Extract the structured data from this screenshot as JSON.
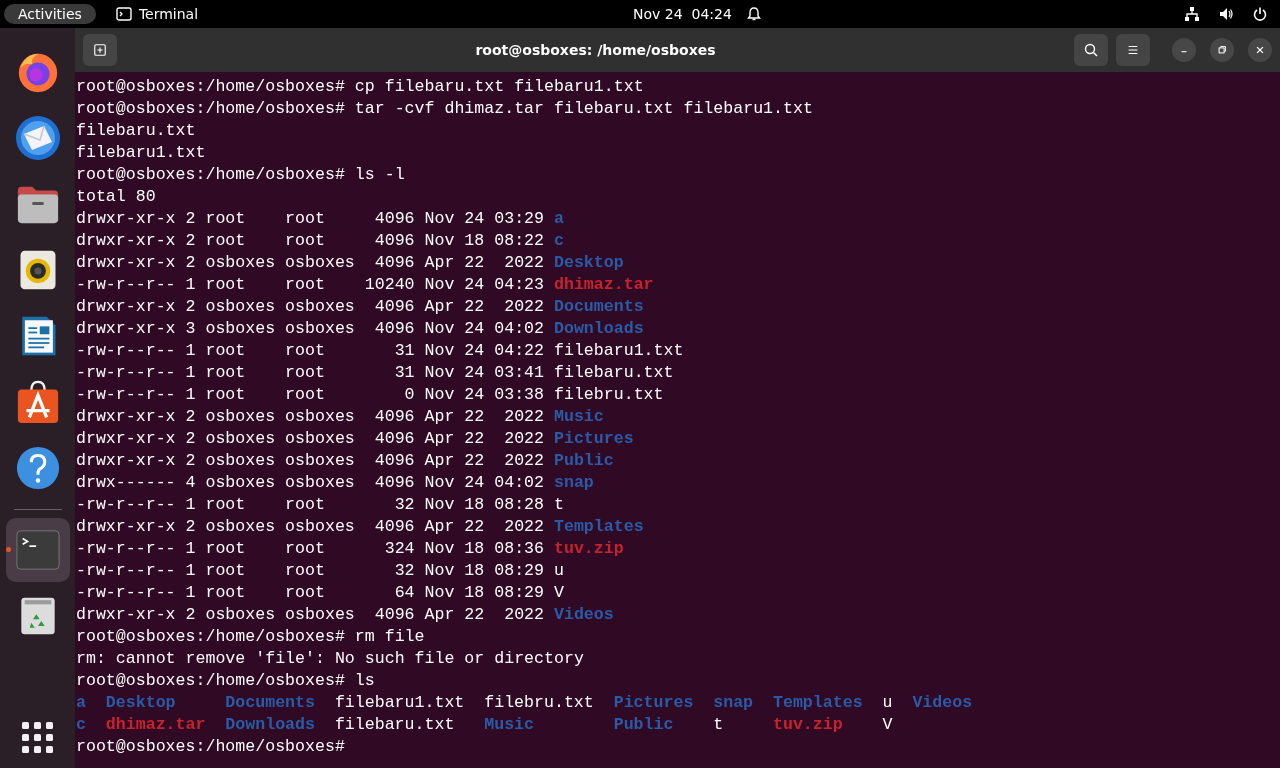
{
  "top_bar": {
    "activities": "Activities",
    "app_name": "Terminal",
    "clock": "Nov 24  04:24"
  },
  "dock": [
    {
      "kind": "browser",
      "running": false,
      "active": false
    },
    {
      "kind": "mail",
      "running": false,
      "active": false
    },
    {
      "kind": "files",
      "running": false,
      "active": false
    },
    {
      "kind": "music",
      "running": false,
      "active": false
    },
    {
      "kind": "writer",
      "running": false,
      "active": false
    },
    {
      "kind": "software",
      "running": false,
      "active": false
    },
    {
      "kind": "help",
      "running": false,
      "active": false
    },
    {
      "kind": "separator"
    },
    {
      "kind": "terminal",
      "running": true,
      "active": true
    },
    {
      "kind": "trash",
      "running": false,
      "active": false
    }
  ],
  "window": {
    "title": "root@osboxes: /home/osboxes"
  },
  "terminal": {
    "lines": [
      {
        "kind": "text",
        "text": "root@osboxes:/home/osboxes# cp filebaru.txt filebaru1.txt"
      },
      {
        "kind": "text",
        "text": "root@osboxes:/home/osboxes# tar -cvf dhimaz.tar filebaru.txt filebaru1.txt"
      },
      {
        "kind": "text",
        "text": "filebaru.txt"
      },
      {
        "kind": "text",
        "text": "filebaru1.txt"
      },
      {
        "kind": "text",
        "text": "root@osboxes:/home/osboxes# ls -l"
      },
      {
        "kind": "text",
        "text": "total 80"
      },
      {
        "kind": "entry",
        "info": "drwxr-xr-x 2 root    root     4096 Nov 24 03:29",
        "file": {
          "name": "a",
          "kind": "dir"
        }
      },
      {
        "kind": "entry",
        "info": "drwxr-xr-x 2 root    root     4096 Nov 18 08:22",
        "file": {
          "name": "c",
          "kind": "dir"
        }
      },
      {
        "kind": "entry",
        "info": "drwxr-xr-x 2 osboxes osboxes  4096 Apr 22  2022",
        "file": {
          "name": "Desktop",
          "kind": "dir"
        }
      },
      {
        "kind": "entry",
        "info": "-rw-r--r-- 1 root    root    10240 Nov 24 04:23",
        "file": {
          "name": "dhimaz.tar",
          "kind": "archive"
        }
      },
      {
        "kind": "entry",
        "info": "drwxr-xr-x 2 osboxes osboxes  4096 Apr 22  2022",
        "file": {
          "name": "Documents",
          "kind": "dir"
        }
      },
      {
        "kind": "entry",
        "info": "drwxr-xr-x 3 osboxes osboxes  4096 Nov 24 04:02",
        "file": {
          "name": "Downloads",
          "kind": "dir"
        }
      },
      {
        "kind": "entry",
        "info": "-rw-r--r-- 1 root    root       31 Nov 24 04:22",
        "file": {
          "name": "filebaru1.txt",
          "kind": "file"
        }
      },
      {
        "kind": "entry",
        "info": "-rw-r--r-- 1 root    root       31 Nov 24 03:41",
        "file": {
          "name": "filebaru.txt",
          "kind": "file"
        }
      },
      {
        "kind": "entry",
        "info": "-rw-r--r-- 1 root    root        0 Nov 24 03:38",
        "file": {
          "name": "filebru.txt",
          "kind": "file"
        }
      },
      {
        "kind": "entry",
        "info": "drwxr-xr-x 2 osboxes osboxes  4096 Apr 22  2022",
        "file": {
          "name": "Music",
          "kind": "dir"
        }
      },
      {
        "kind": "entry",
        "info": "drwxr-xr-x 2 osboxes osboxes  4096 Apr 22  2022",
        "file": {
          "name": "Pictures",
          "kind": "dir"
        }
      },
      {
        "kind": "entry",
        "info": "drwxr-xr-x 2 osboxes osboxes  4096 Apr 22  2022",
        "file": {
          "name": "Public",
          "kind": "dir"
        }
      },
      {
        "kind": "entry",
        "info": "drwx------ 4 osboxes osboxes  4096 Nov 24 04:02",
        "file": {
          "name": "snap",
          "kind": "dir"
        }
      },
      {
        "kind": "entry",
        "info": "-rw-r--r-- 1 root    root       32 Nov 18 08:28",
        "file": {
          "name": "t",
          "kind": "file"
        }
      },
      {
        "kind": "entry",
        "info": "drwxr-xr-x 2 osboxes osboxes  4096 Apr 22  2022",
        "file": {
          "name": "Templates",
          "kind": "dir"
        }
      },
      {
        "kind": "entry",
        "info": "-rw-r--r-- 1 root    root      324 Nov 18 08:36",
        "file": {
          "name": "tuv.zip",
          "kind": "archive"
        }
      },
      {
        "kind": "entry",
        "info": "-rw-r--r-- 1 root    root       32 Nov 18 08:29",
        "file": {
          "name": "u",
          "kind": "file"
        }
      },
      {
        "kind": "entry",
        "info": "-rw-r--r-- 1 root    root       64 Nov 18 08:29",
        "file": {
          "name": "V",
          "kind": "file"
        }
      },
      {
        "kind": "entry",
        "info": "drwxr-xr-x 2 osboxes osboxes  4096 Apr 22  2022",
        "file": {
          "name": "Videos",
          "kind": "dir"
        }
      },
      {
        "kind": "text",
        "text": "root@osboxes:/home/osboxes# rm file"
      },
      {
        "kind": "text",
        "text": "rm: cannot remove 'file': No such file or directory"
      },
      {
        "kind": "text",
        "text": "root@osboxes:/home/osboxes# ls"
      },
      {
        "kind": "columns",
        "columns": [
          [
            {
              "name": "a",
              "kind": "dir"
            },
            {
              "name": "c",
              "kind": "dir"
            }
          ],
          [
            {
              "name": "Desktop",
              "kind": "dir"
            },
            {
              "name": "dhimaz.tar",
              "kind": "archive"
            }
          ],
          [
            {
              "name": "Documents",
              "kind": "dir"
            },
            {
              "name": "Downloads",
              "kind": "dir"
            }
          ],
          [
            {
              "name": "filebaru1.txt",
              "kind": "file"
            },
            {
              "name": "filebaru.txt",
              "kind": "file"
            }
          ],
          [
            {
              "name": "filebru.txt",
              "kind": "file"
            },
            {
              "name": "Music",
              "kind": "dir"
            }
          ],
          [
            {
              "name": "Pictures",
              "kind": "dir"
            },
            {
              "name": "Public",
              "kind": "dir"
            }
          ],
          [
            {
              "name": "snap",
              "kind": "dir"
            },
            {
              "name": "t",
              "kind": "file"
            }
          ],
          [
            {
              "name": "Templates",
              "kind": "dir"
            },
            {
              "name": "tuv.zip",
              "kind": "archive"
            }
          ],
          [
            {
              "name": "u",
              "kind": "file"
            },
            {
              "name": "V",
              "kind": "file"
            }
          ],
          [
            {
              "name": "Videos",
              "kind": "dir"
            }
          ]
        ]
      },
      {
        "kind": "text",
        "text": "root@osboxes:/home/osboxes#"
      }
    ]
  }
}
